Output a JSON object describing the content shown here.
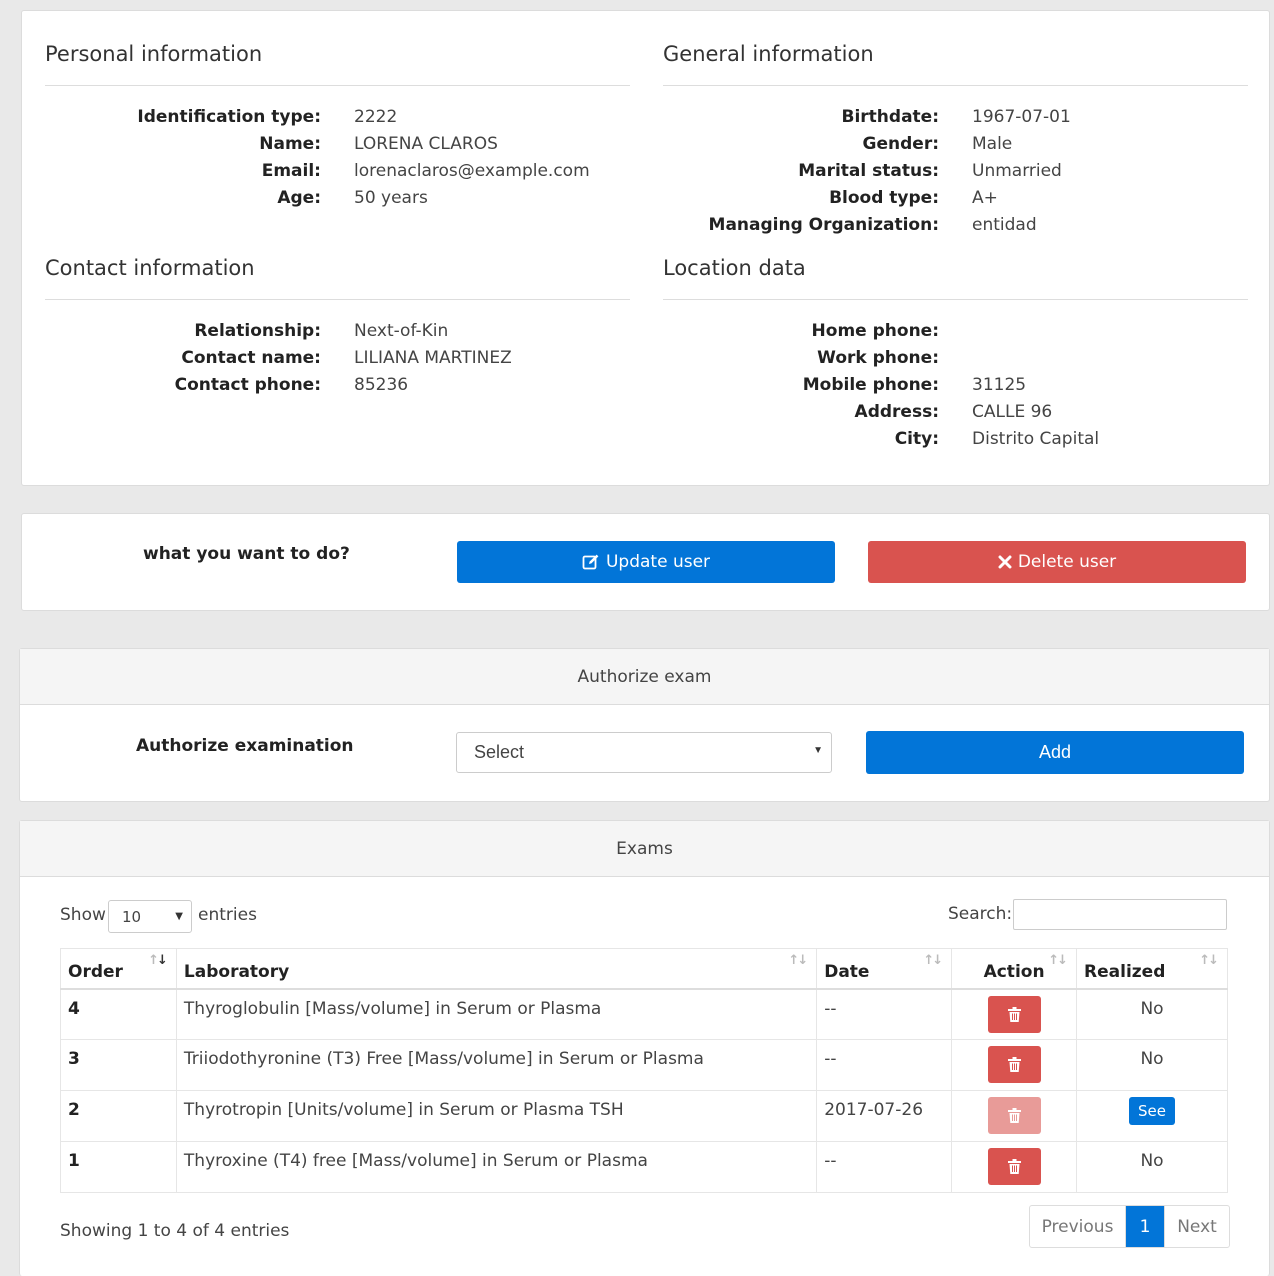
{
  "personal": {
    "title": "Personal information",
    "rows": [
      {
        "label": "Identification type:",
        "value": "2222"
      },
      {
        "label": "Name:",
        "value": "LORENA CLAROS"
      },
      {
        "label": "Email:",
        "value": "lorenaclaros@example.com"
      },
      {
        "label": "Age:",
        "value": "50 years"
      }
    ]
  },
  "general": {
    "title": "General information",
    "rows": [
      {
        "label": "Birthdate:",
        "value": "1967-07-01"
      },
      {
        "label": "Gender:",
        "value": "Male"
      },
      {
        "label": "Marital status:",
        "value": "Unmarried"
      },
      {
        "label": "Blood type:",
        "value": "A+"
      },
      {
        "label": "Managing Organization:",
        "value": "entidad"
      }
    ]
  },
  "contact": {
    "title": "Contact information",
    "rows": [
      {
        "label": "Relationship:",
        "value": "Next-of-Kin"
      },
      {
        "label": "Contact name:",
        "value": "LILIANA MARTINEZ"
      },
      {
        "label": "Contact phone:",
        "value": "85236"
      }
    ]
  },
  "location": {
    "title": "Location data",
    "rows": [
      {
        "label": "Home phone:",
        "value": ""
      },
      {
        "label": "Work phone:",
        "value": ""
      },
      {
        "label": "Mobile phone:",
        "value": "31125"
      },
      {
        "label": "Address:",
        "value": "CALLE 96"
      },
      {
        "label": "City:",
        "value": "Distrito Capital"
      }
    ]
  },
  "actions": {
    "prompt": "what you want to do?",
    "update_label": "Update user",
    "update_icon": "edit-icon",
    "delete_label": "Delete user",
    "delete_icon": "times-icon"
  },
  "authorize": {
    "header": "Authorize exam",
    "label": "Authorize examination",
    "select_value": "Select",
    "add_label": "Add"
  },
  "exams": {
    "header": "Exams",
    "show_label": "Show",
    "page_length": "10",
    "entries_label": "entries",
    "search_label": "Search:",
    "columns": [
      "Order",
      "Laboratory",
      "Date",
      "Action",
      "Realized"
    ],
    "rows": [
      {
        "order": "4",
        "laboratory": "Thyroglobulin [Mass/volume] in Serum or Plasma",
        "date": "--",
        "realized": "No"
      },
      {
        "order": "3",
        "laboratory": "Triiodothyronine (T3) Free [Mass/volume] in Serum or Plasma",
        "date": "--",
        "realized": "No"
      },
      {
        "order": "2",
        "laboratory": "Thyrotropin [Units/volume] in Serum or Plasma TSH",
        "date": "2017-07-26",
        "realized": "See"
      },
      {
        "order": "1",
        "laboratory": "Thyroxine (T4) free [Mass/volume] in Serum or Plasma",
        "date": "--",
        "realized": "No"
      }
    ],
    "info": "Showing 1 to 4 of 4 entries",
    "pagination": {
      "previous": "Previous",
      "current": "1",
      "next": "Next"
    }
  },
  "colors": {
    "primary": "#0275d8",
    "danger": "#d9534f",
    "background": "#e9e9e9"
  }
}
